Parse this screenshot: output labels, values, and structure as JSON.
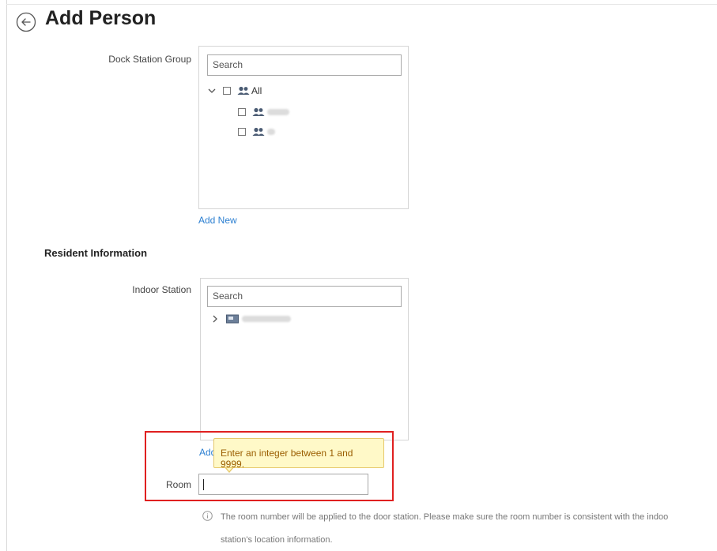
{
  "page": {
    "title": "Add Person"
  },
  "dock_station_group": {
    "label": "Dock Station Group",
    "search_placeholder": "Search",
    "tree": {
      "root_label": "All",
      "children": [
        {
          "label": ""
        },
        {
          "label": ""
        }
      ]
    },
    "add_new_label": "Add New"
  },
  "resident_information": {
    "title": "Resident Information",
    "indoor_station": {
      "label": "Indoor Station",
      "search_placeholder": "Search",
      "tree": {
        "root_label": ""
      },
      "add_new_label_partial": "Add"
    },
    "room": {
      "label": "Room",
      "value": "",
      "tooltip": "Enter an integer between 1 and 9999."
    },
    "hint_line1": "The room number will be applied to the door station. Please make sure the room number is consistent with the indoo",
    "hint_line2": "station's location information."
  },
  "icons": {
    "back": "back-arrow-circle-icon",
    "group": "person-group-icon",
    "device": "indoor-station-icon",
    "info": "info-icon"
  },
  "colors": {
    "link": "#2b7fd1",
    "highlight": "#e02020",
    "tooltip_bg": "#fff9c8",
    "tooltip_text": "#9a5d00"
  }
}
